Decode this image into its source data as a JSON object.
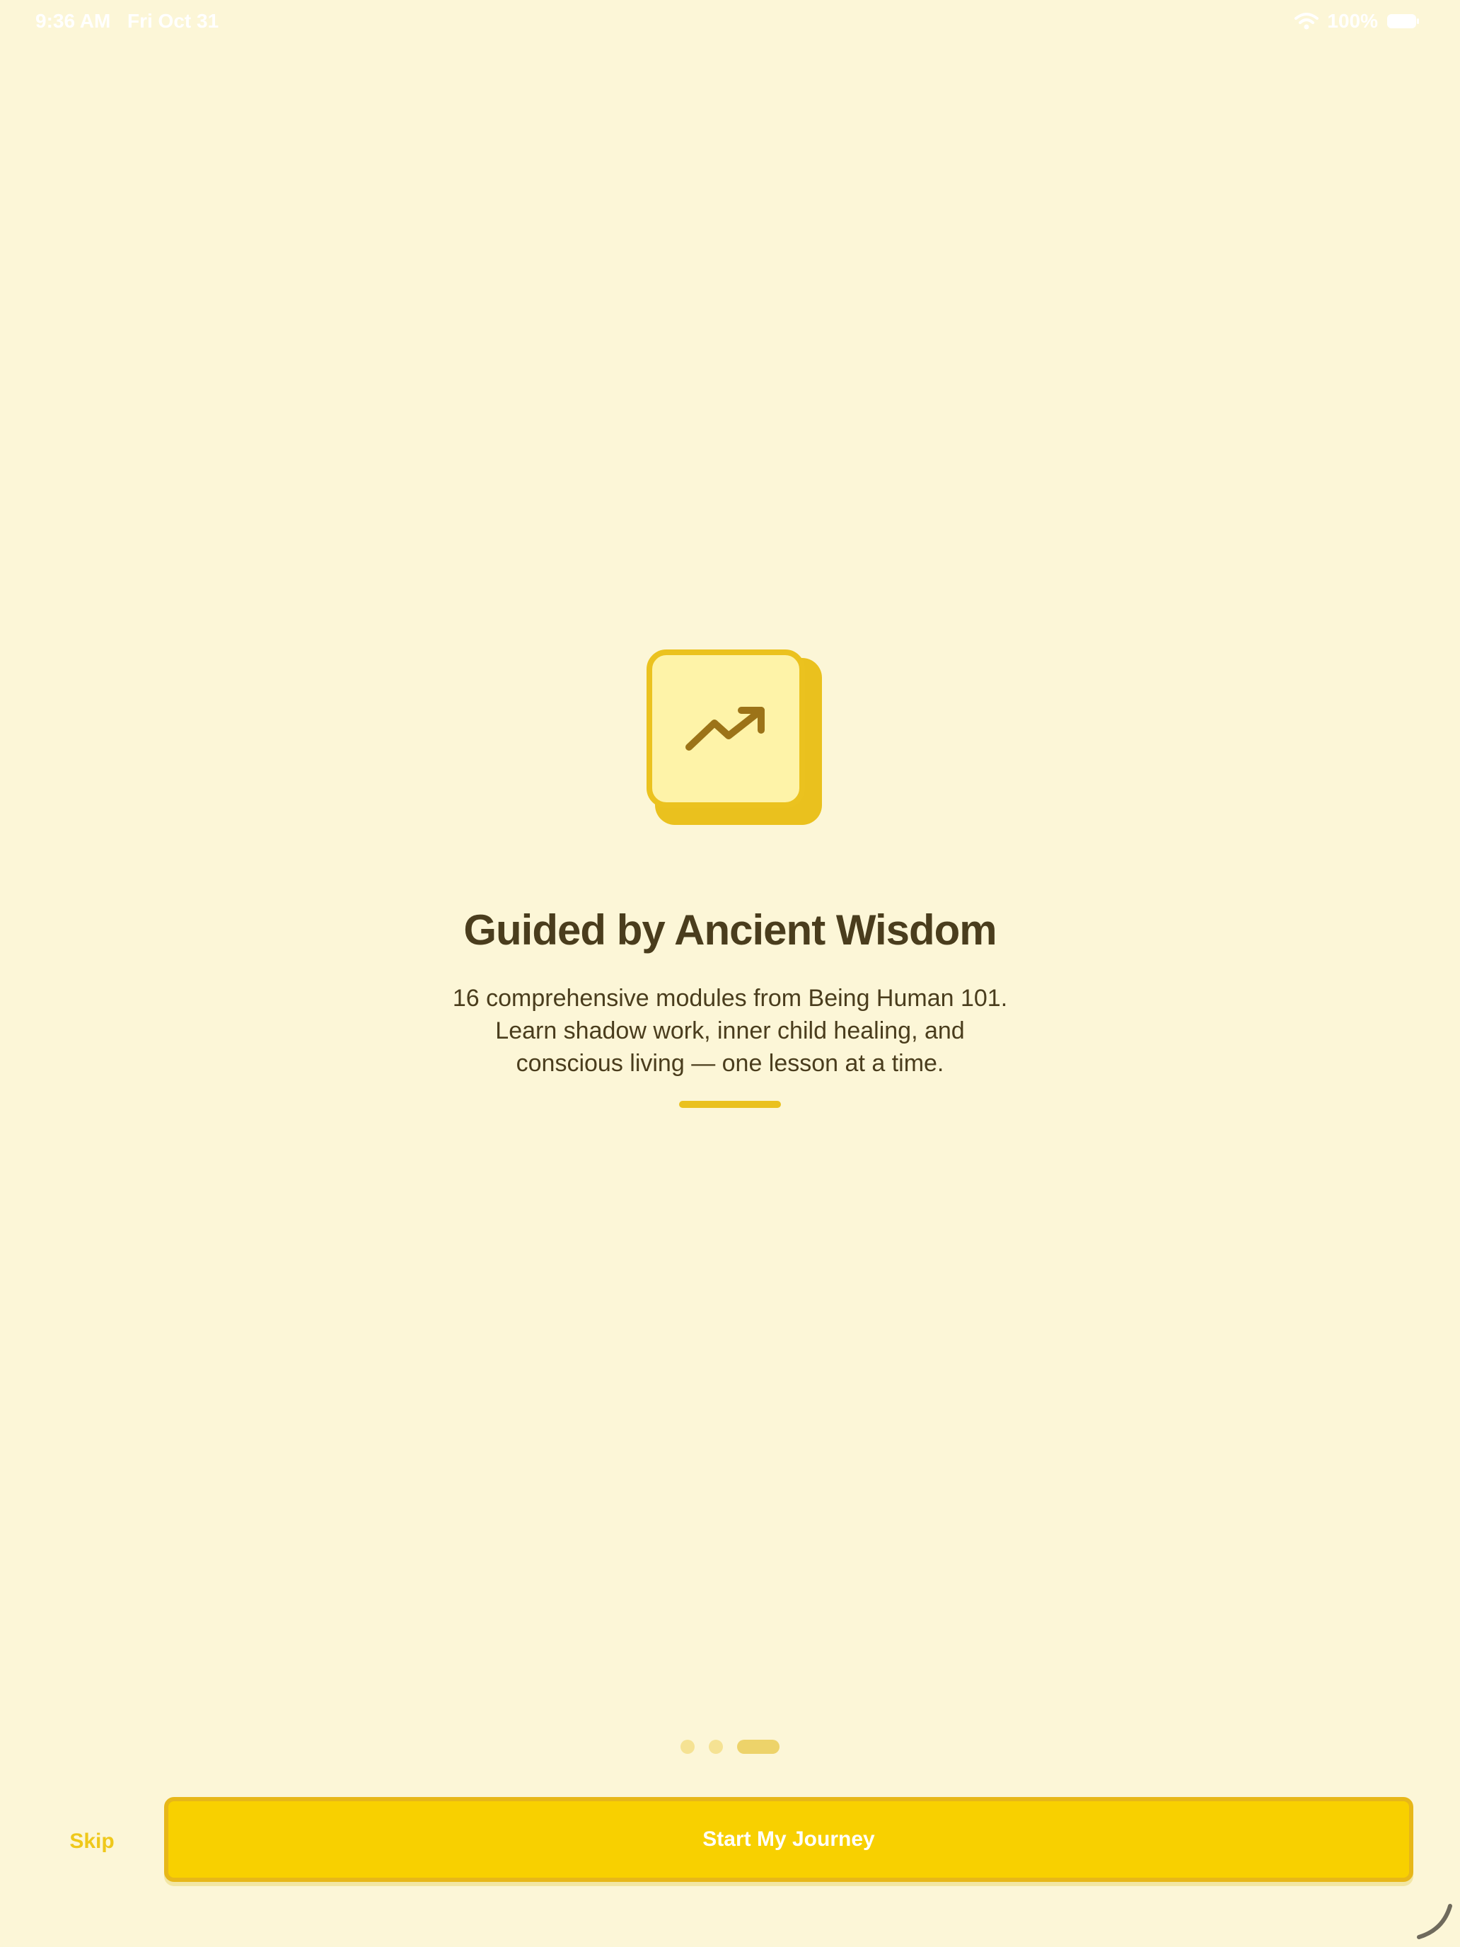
{
  "status_bar": {
    "time": "9:36 AM",
    "date": "Fri Oct 31",
    "battery_percent": "100%",
    "icons": [
      "wifi-icon",
      "battery-icon"
    ]
  },
  "onboarding": {
    "icon": "trending-up-icon",
    "title": "Guided by Ancient Wisdom",
    "description": "16 comprehensive modules from Being Human 101. Learn shadow work, inner child healing, and conscious living — one lesson at a time.",
    "page_indicator": {
      "total": 3,
      "current": 3
    }
  },
  "actions": {
    "skip_label": "Skip",
    "primary_label": "Start My Journey"
  },
  "colors": {
    "background": "#FCF6D7",
    "accent": "#F8D000",
    "accent_dark": "#E7B719",
    "text": "#4A3D1D",
    "icon_fill": "#FEF3A8",
    "icon_stroke": "#9C7318"
  }
}
